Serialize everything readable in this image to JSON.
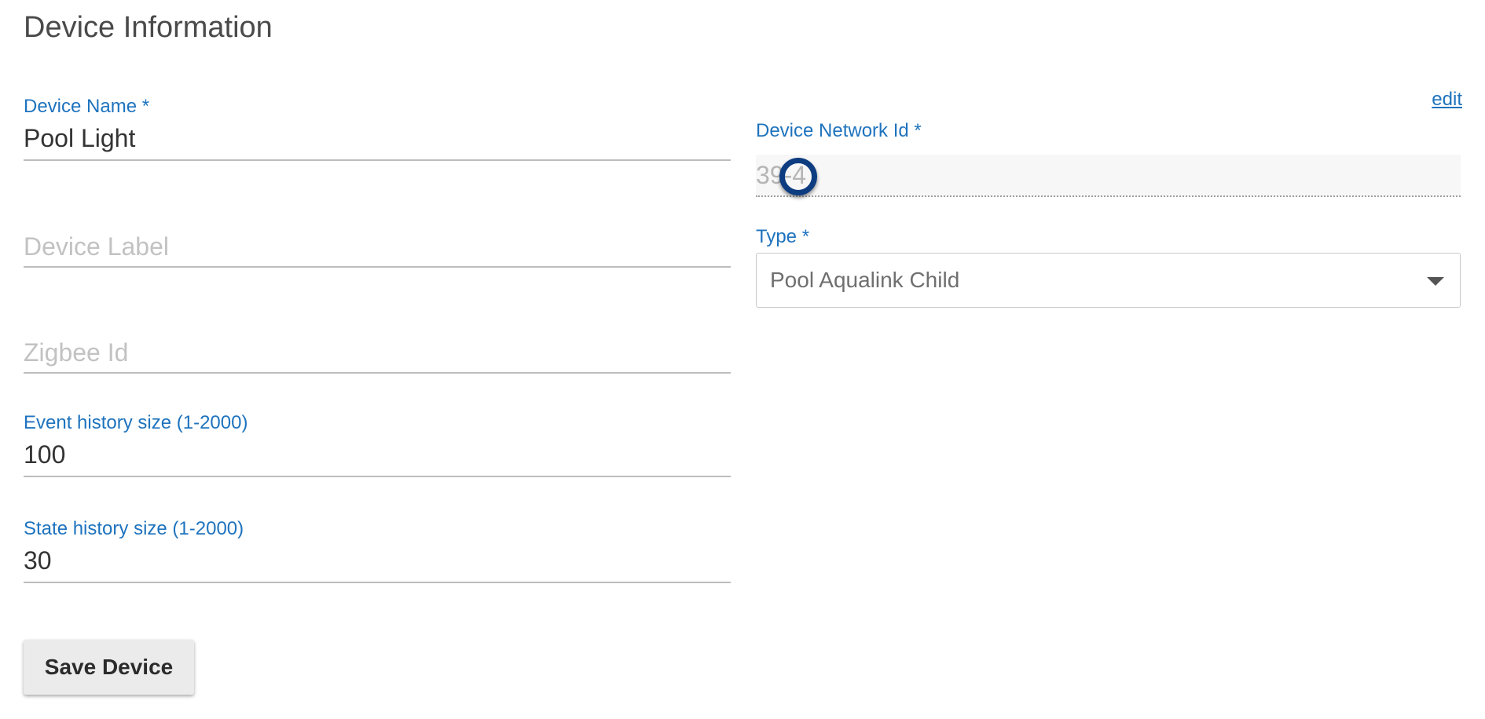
{
  "page": {
    "title": "Device Information"
  },
  "left_fields": {
    "device_name": {
      "label": "Device Name *",
      "value": "Pool Light"
    },
    "device_label": {
      "placeholder": "Device Label"
    },
    "zigbee_id": {
      "placeholder": "Zigbee Id"
    },
    "event_history": {
      "label": "Event history size (1-2000)",
      "value": "100"
    },
    "state_history": {
      "label": "State history size (1-2000)",
      "value": "30"
    }
  },
  "right_fields": {
    "edit_link": "edit",
    "network_id": {
      "label": "Device Network Id *",
      "value": "39-4"
    },
    "type": {
      "label": "Type *",
      "selected": "Pool Aqualink Child"
    }
  },
  "actions": {
    "save_label": "Save Device"
  },
  "colors": {
    "label_blue": "#1e73be",
    "cursor_ring": "#0d3c80"
  }
}
